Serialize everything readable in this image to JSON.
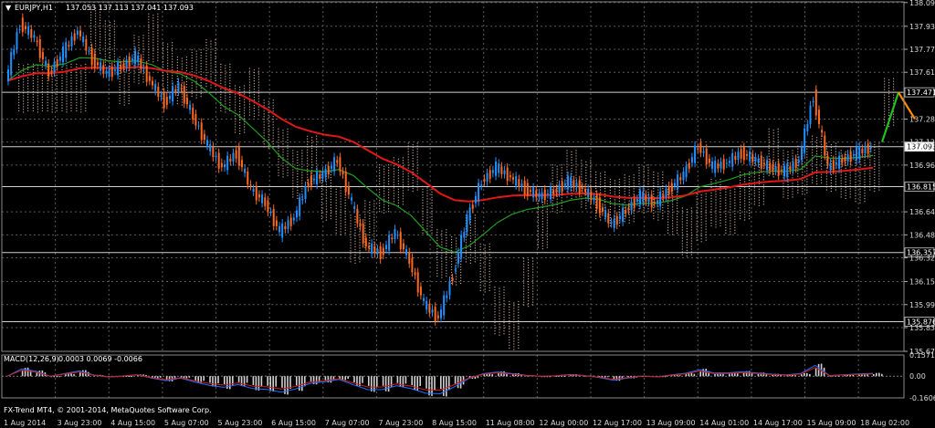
{
  "chart_header": {
    "menu_glyph": "▼",
    "symbol_timeframe": "EURJPY,H1",
    "ohlc": "137.053 137.113 137.041 137.093"
  },
  "indicator_header": {
    "label": "MACD(12,26,9)",
    "values": "0.0003 0.0069 -0.0066"
  },
  "copyright": "FX-Trend MT4, © 2001-2014, MetaQuotes Software Corp.",
  "colors": {
    "background": "#000000",
    "grid": "#5a5a5a",
    "bull": "#1e90ff",
    "bear": "#ff6a20",
    "ema_red": "#e01818",
    "ema_green": "#1f9d1f",
    "cloud": "#d8b8a0",
    "level_line": "#cfcfcf",
    "arrow_up": "#20c020",
    "arrow_down": "#ff8c00"
  },
  "chart_data": {
    "type": "candlestick",
    "price_axis": {
      "ticks": [
        "138.095",
        "137.930",
        "137.770",
        "137.610",
        "137.285",
        "137.125",
        "136.965",
        "136.640",
        "136.480",
        "136.320",
        "136.155",
        "135.995",
        "135.835",
        "135.670"
      ],
      "range": [
        135.67,
        138.1
      ]
    },
    "levels": [
      {
        "label": "137.471",
        "value": 137.471
      },
      {
        "label": "137.093",
        "value": 137.093,
        "current": true
      },
      {
        "label": "136.815",
        "value": 136.815
      },
      {
        "label": "136.357",
        "value": 136.357
      },
      {
        "label": "135.876",
        "value": 135.876
      }
    ],
    "time_axis": [
      "1 Aug 2014",
      "3 Aug 23:00",
      "4 Aug 15:00",
      "5 Aug 07:00",
      "5 Aug 23:00",
      "6 Aug 15:00",
      "7 Aug 07:00",
      "7 Aug 23:00",
      "8 Aug 15:00",
      "11 Aug 08:00",
      "12 Aug 00:00",
      "12 Aug 17:00",
      "13 Aug 09:00",
      "14 Aug 01:00",
      "14 Aug 17:00",
      "15 Aug 09:00",
      "18 Aug 02:00"
    ],
    "close_path": [
      137.55,
      137.95,
      137.85,
      137.6,
      137.75,
      137.9,
      137.7,
      137.6,
      137.65,
      137.72,
      137.55,
      137.4,
      137.52,
      137.3,
      137.1,
      136.95,
      137.05,
      136.8,
      136.7,
      136.5,
      136.6,
      136.85,
      136.9,
      137.0,
      136.7,
      136.4,
      136.35,
      136.5,
      136.3,
      136.0,
      135.9,
      136.2,
      136.6,
      136.85,
      136.95,
      136.88,
      136.8,
      136.75,
      136.78,
      136.85,
      136.8,
      136.7,
      136.55,
      136.65,
      136.75,
      136.7,
      136.8,
      136.9,
      137.1,
      136.95,
      136.98,
      137.05,
      137.0,
      136.95,
      136.92,
      137.0,
      137.45,
      136.95,
      137.0,
      137.05,
      137.09
    ],
    "macd_axis": {
      "ticks": [
        "0.1571",
        "0.00",
        "-0.1606"
      ],
      "range": [
        -0.1606,
        0.1571
      ]
    },
    "forecast_arrows": [
      {
        "direction": "up",
        "from": 137.125,
        "to": 137.47
      },
      {
        "direction": "down",
        "from": 137.47,
        "to": 137.285
      }
    ]
  }
}
